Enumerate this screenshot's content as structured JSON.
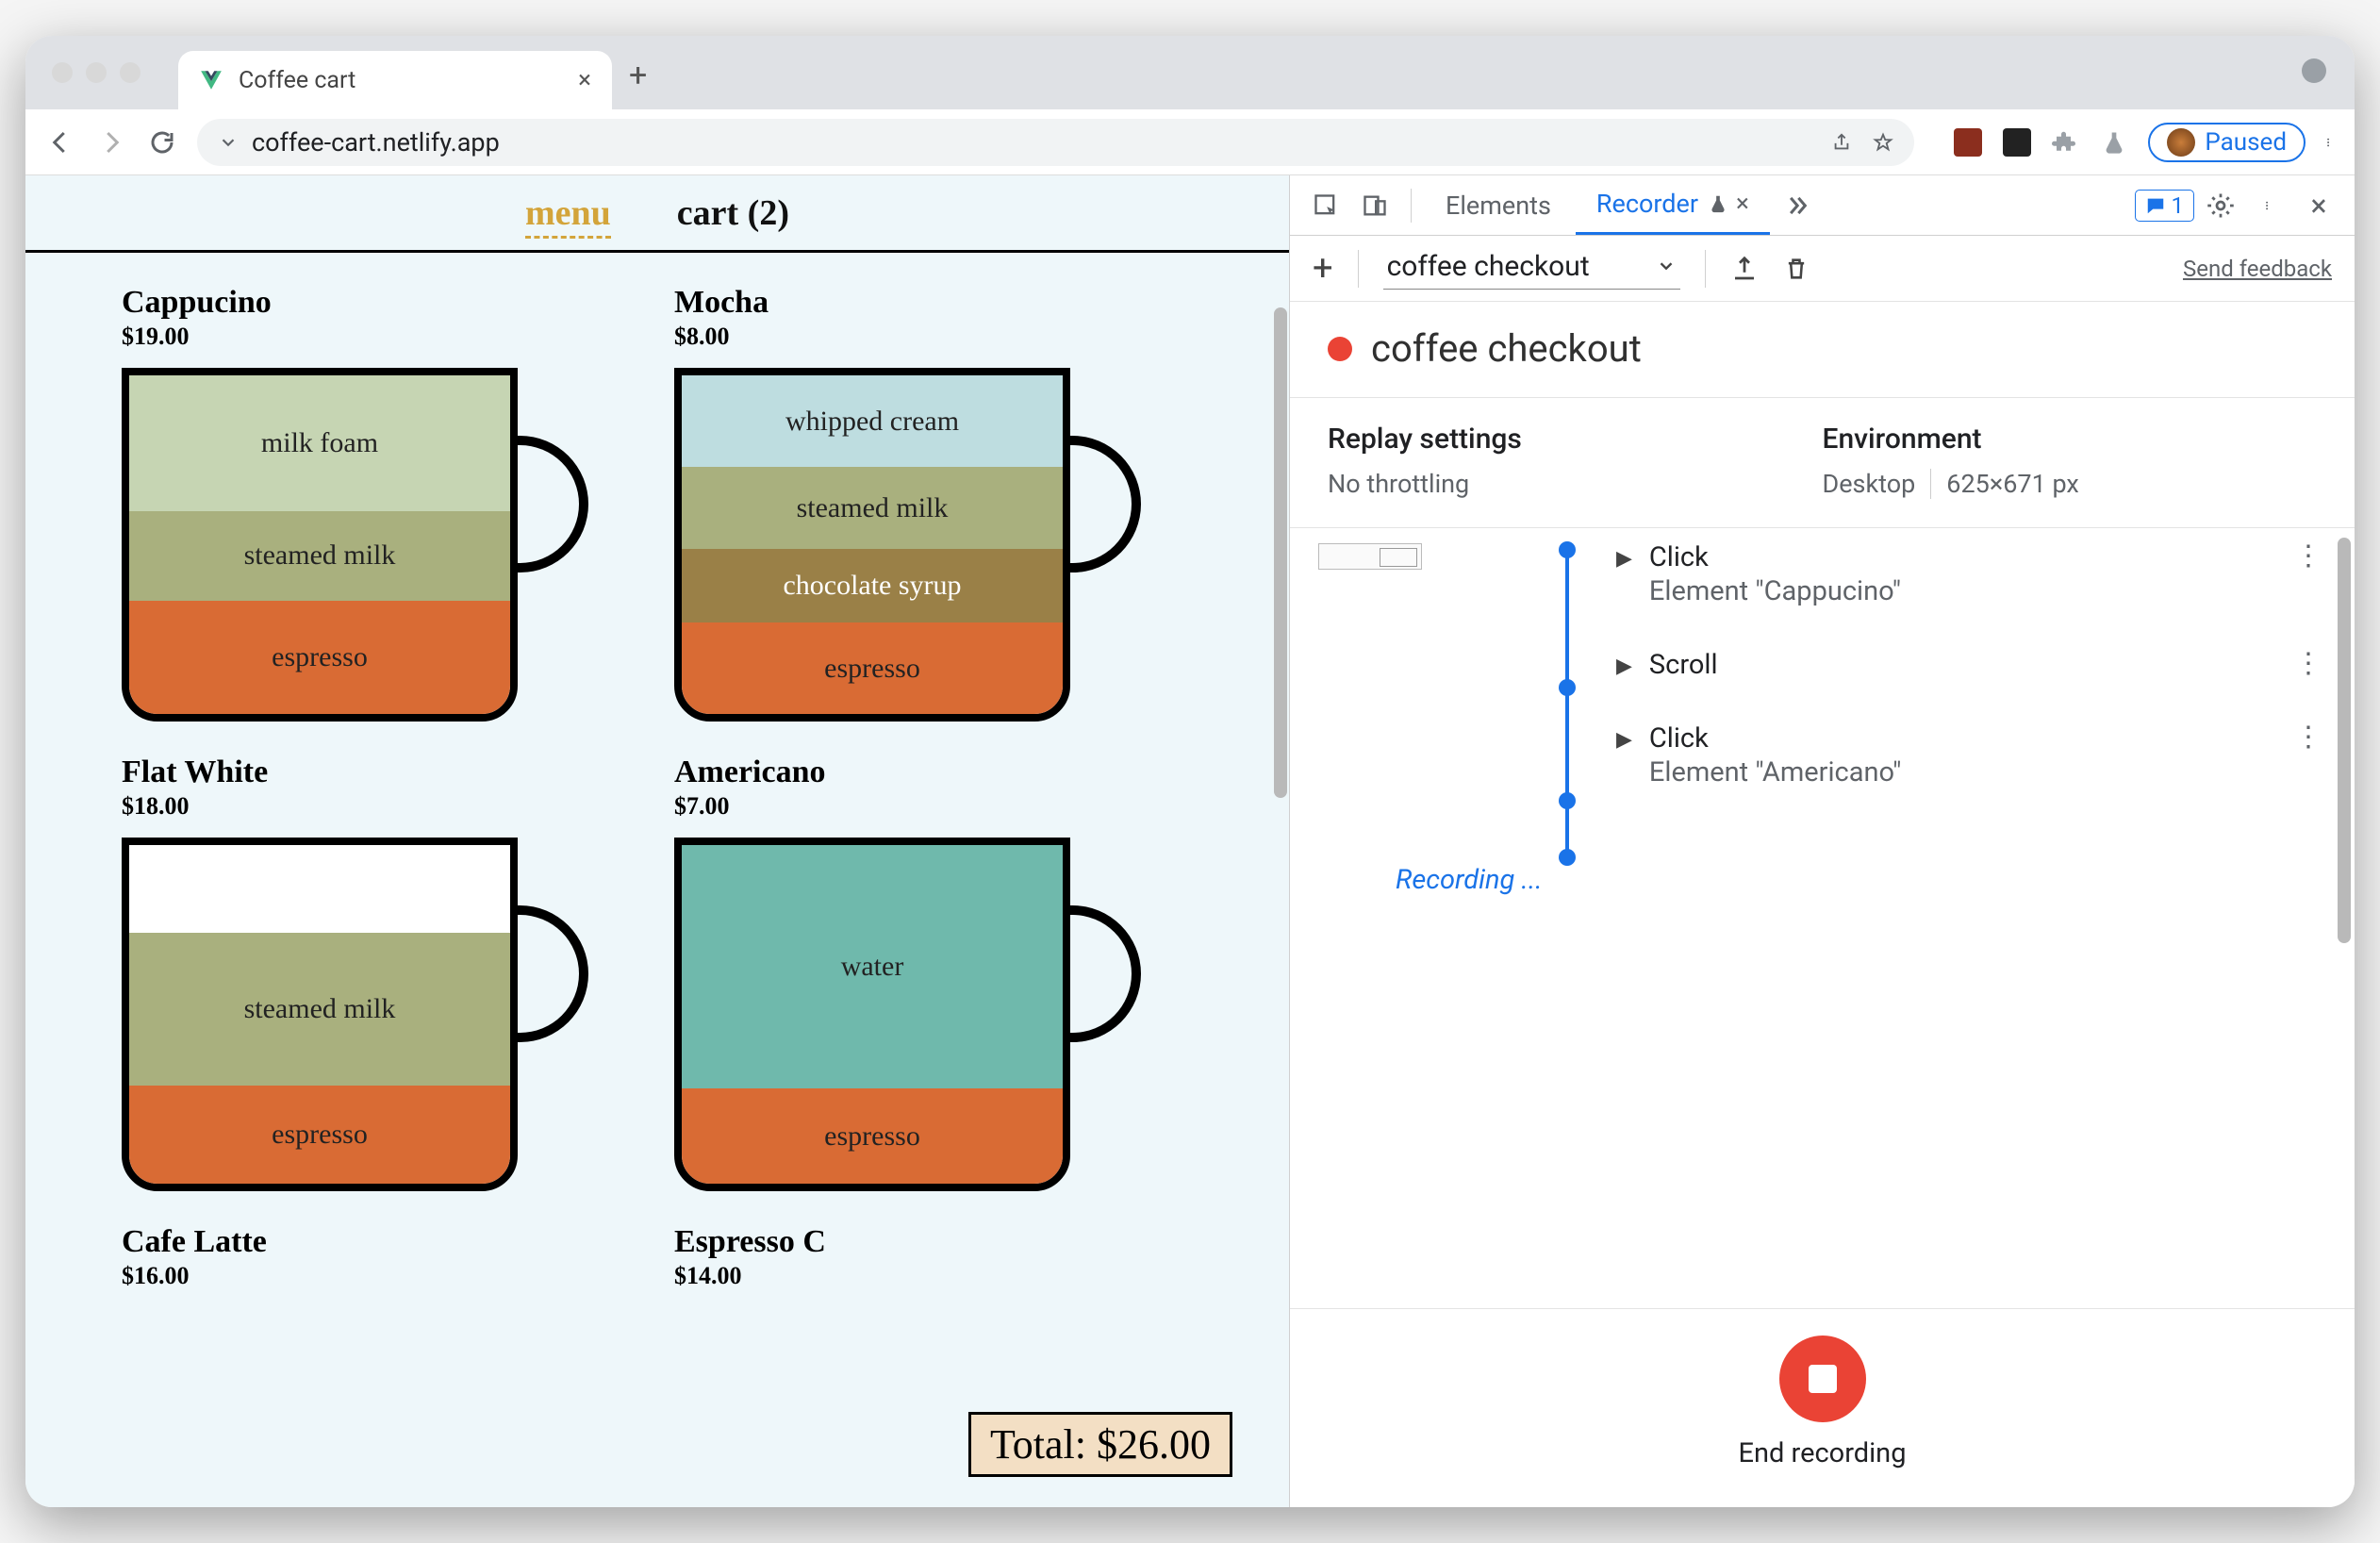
{
  "browser": {
    "tab_title": "Coffee cart",
    "url": "coffee-cart.netlify.app",
    "paused_label": "Paused"
  },
  "page": {
    "nav": {
      "menu": "menu",
      "cart": "cart (2)"
    },
    "products": [
      {
        "name": "Cappucino",
        "price": "$19.00",
        "layers": [
          {
            "label": "milk foam",
            "cls": "c-milkfoam",
            "flex": 1.2
          },
          {
            "label": "steamed milk",
            "cls": "c-steamed",
            "flex": 0.8
          },
          {
            "label": "espresso",
            "cls": "c-espresso",
            "flex": 1.0
          }
        ]
      },
      {
        "name": "Mocha",
        "price": "$8.00",
        "layers": [
          {
            "label": "whipped cream",
            "cls": "c-whip",
            "flex": 1.0
          },
          {
            "label": "steamed milk",
            "cls": "c-steamed",
            "flex": 0.9
          },
          {
            "label": "chocolate syrup",
            "cls": "c-choco",
            "flex": 0.8
          },
          {
            "label": "espresso",
            "cls": "c-espresso",
            "flex": 1.0
          }
        ]
      },
      {
        "name": "Flat White",
        "price": "$18.00",
        "layers": [
          {
            "label": "",
            "cls": "c-empty",
            "flex": 0.8
          },
          {
            "label": "steamed milk",
            "cls": "c-steamed",
            "flex": 1.4
          },
          {
            "label": "espresso",
            "cls": "c-espresso",
            "flex": 0.9
          }
        ]
      },
      {
        "name": "Americano",
        "price": "$7.00",
        "layers": [
          {
            "label": "water",
            "cls": "c-water",
            "flex": 2.3
          },
          {
            "label": "espresso",
            "cls": "c-espresso",
            "flex": 0.9
          }
        ]
      },
      {
        "name": "Cafe Latte",
        "price": "$16.00",
        "layers": []
      },
      {
        "name": "Espresso C",
        "price": "$14.00",
        "layers": []
      }
    ],
    "total_label": "Total: $26.00"
  },
  "devtools": {
    "tabs": {
      "elements": "Elements",
      "recorder": "Recorder"
    },
    "issues_count": "1",
    "recording_name": "coffee checkout",
    "feedback": "Send feedback",
    "title": "coffee checkout",
    "replay": {
      "heading": "Replay settings",
      "value": "No throttling"
    },
    "env": {
      "heading": "Environment",
      "device": "Desktop",
      "size": "625×671 px"
    },
    "steps": [
      {
        "title": "Click",
        "sub": "Element \"Cappucino\""
      },
      {
        "title": "Scroll",
        "sub": ""
      },
      {
        "title": "Click",
        "sub": "Element \"Americano\""
      }
    ],
    "recording_label": "Recording ...",
    "end_label": "End recording"
  }
}
